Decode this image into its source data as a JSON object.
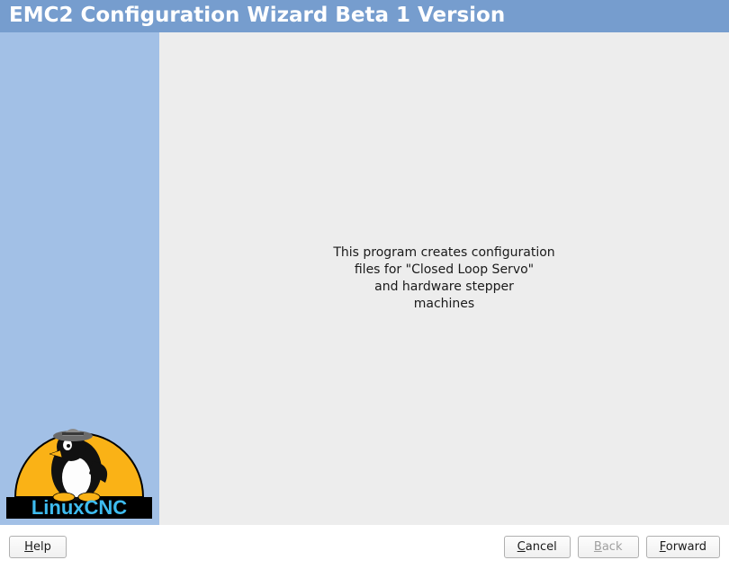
{
  "title_bar": {
    "text": "EMC2  Configuration Wizard   Beta 1 Version"
  },
  "sidebar": {
    "logo_label": "LinuxCNC"
  },
  "content": {
    "message_line1": "This program creates configuration",
    "message_line2": "files  for  \"Closed Loop Servo\"",
    "message_line3": "and hardware stepper",
    "message_line4": "machines"
  },
  "buttons": {
    "help_label_pre": "",
    "help_mnemonic": "H",
    "help_label_post": "elp",
    "cancel_label_pre": "",
    "cancel_mnemonic": "C",
    "cancel_label_post": "ancel",
    "back_label_pre": "",
    "back_mnemonic": "B",
    "back_label_post": "ack",
    "back_disabled": true,
    "forward_label_pre": "",
    "forward_mnemonic": "F",
    "forward_label_post": "orward"
  },
  "colors": {
    "title_bar_bg": "#769dce",
    "sidebar_bg": "#a2c0e6",
    "content_bg": "#ededed",
    "logo_text": "#3ebcf0",
    "logo_banner": "#000000",
    "logo_sun": "#fab216"
  }
}
